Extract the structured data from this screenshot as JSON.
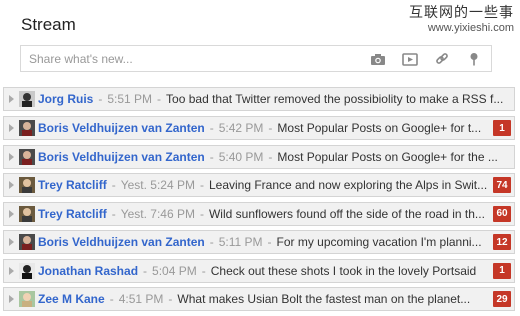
{
  "header": {
    "title": "Stream"
  },
  "watermark": {
    "text": "互联网的一些事",
    "url": "www.yixieshi.com"
  },
  "share": {
    "placeholder": "Share what's new..."
  },
  "colors": {
    "author": "#3366cc",
    "badge": "#c53727",
    "row_bg": "#f1f1f1"
  },
  "posts": [
    {
      "author": "Jorg Ruis",
      "time": "5:51 PM",
      "snippet": "Too bad that Twitter removed the possibiolity to make a RSS f...",
      "count": ""
    },
    {
      "author": "Boris Veldhuijzen van Zanten",
      "time": "5:42 PM",
      "snippet": "Most Popular Posts on Google+ for t...",
      "count": "1"
    },
    {
      "author": "Boris Veldhuijzen van Zanten",
      "time": "5:40 PM",
      "snippet": "Most Popular Posts on Google+ for the ...",
      "count": ""
    },
    {
      "author": "Trey Ratcliff",
      "time": "Yest. 5:24 PM",
      "snippet": "Leaving France and now exploring the Alps in Swit...",
      "count": "74"
    },
    {
      "author": "Trey Ratcliff",
      "time": "Yest. 7:46 PM",
      "snippet": "Wild sunflowers found off the side of the road in th...",
      "count": "60"
    },
    {
      "author": "Boris Veldhuijzen van Zanten",
      "time": "5:11 PM",
      "snippet": "For my upcoming vacation I'm planni...",
      "count": "12"
    },
    {
      "author": "Jonathan Rashad",
      "time": "5:04 PM",
      "snippet": "Check out these shots I took in the lovely Portsaid",
      "count": "1"
    },
    {
      "author": "Zee M Kane",
      "time": "4:51 PM",
      "snippet": "What makes Usian Bolt the fastest man on the planet...",
      "count": "29"
    }
  ]
}
